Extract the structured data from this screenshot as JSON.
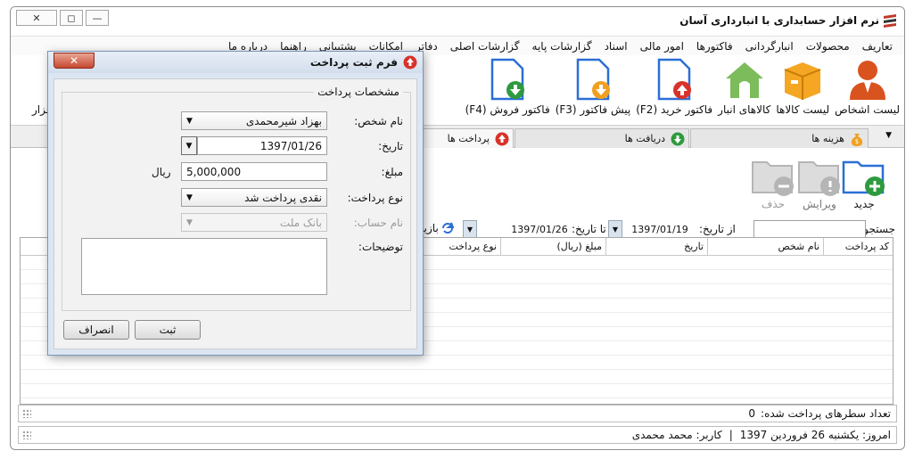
{
  "app": {
    "title": "نرم افزار حسابداری با انبارداری آسان"
  },
  "window_controls": {
    "close": "✕",
    "restore": "◻",
    "minimize": "—"
  },
  "menu": [
    "تعاریف",
    "محصولات",
    "انبارگردانی",
    "فاکتورها",
    "امور مالی",
    "اسناد",
    "گزارشات پایه",
    "گزارشات اصلی",
    "دفاتر",
    "امکانات",
    "پشتیبانی",
    "راهنما",
    "درباره ما"
  ],
  "toolbar": {
    "people": "لیست اشخاص",
    "products": "لیست کالاها",
    "warehouse": "کالاهای انبار",
    "purchase": "فاکتور خرید (F2)",
    "proforma": "پیش فاکتور (F3)",
    "sales": "فاکتور فروش (F4)",
    "partial": "فزار"
  },
  "tabs": {
    "expenses": "هزینه ها",
    "receipts": "دریافت ها",
    "payments": "پرداخت ها"
  },
  "actions": {
    "new": "جدید",
    "edit": "ویرایش",
    "delete": "حذف"
  },
  "search": {
    "label": "جستجو:",
    "from_label": "از تاریخ:",
    "from_date": "1397/01/19",
    "to_label": "تا تاریخ:",
    "to_date": "1397/01/26",
    "refresh": "بازیا"
  },
  "grid": {
    "columns": [
      "کد پرداخت",
      "نام شخص",
      "تاریخ",
      "مبلغ (ریال)",
      "نوع پرداخت"
    ]
  },
  "status": {
    "count_label": "تعداد سطرهای پرداخت شده:",
    "count": "0",
    "today": "امروز: یکشنبه 26 فروردین 1397",
    "separator": "|",
    "user": "کاربر: محمد محمدی"
  },
  "dialog": {
    "title": "فرم ثبت پرداخت",
    "group_title": "مشخصات پرداخت",
    "person_label": "نام شخص:",
    "person_value": "بهزاد شیرمحمدی",
    "date_label": "تاریخ:",
    "date_value": "1397/01/26",
    "amount_label": "مبلغ:",
    "amount_value": "5,000,000",
    "currency": "ریال",
    "type_label": "نوع پرداخت:",
    "type_value": "نقدی پرداخت شد",
    "account_label": "نام حساب:",
    "account_value": "بانک ملت",
    "desc_label": "توضیحات:",
    "save": "ثبت",
    "cancel": "انصراف"
  },
  "colors": {
    "accent": "#2b6fd6",
    "green": "#2e9a3e",
    "red": "#d8322a",
    "orange": "#f0a020"
  }
}
